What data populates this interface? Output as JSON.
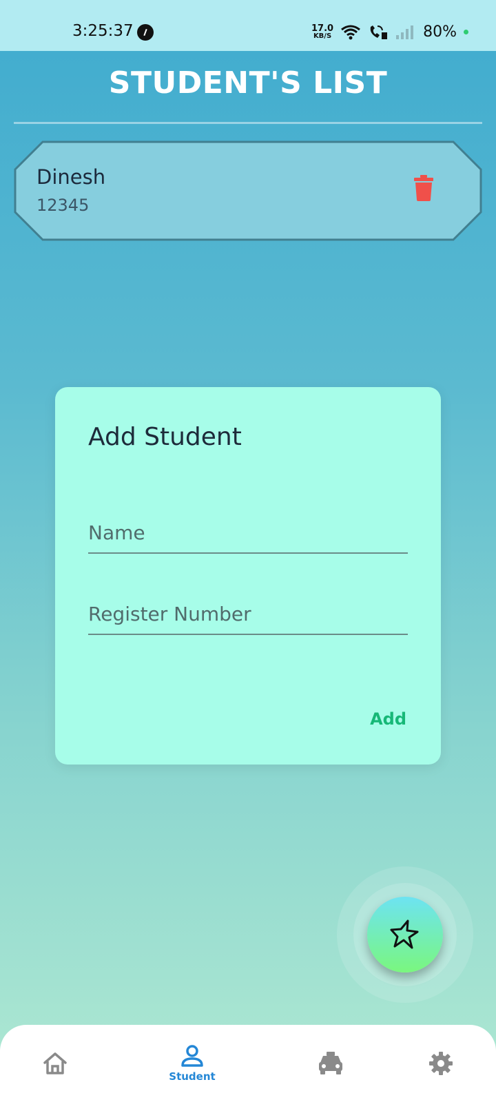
{
  "status_bar": {
    "time": "3:25:37",
    "net_speed_value": "17.0",
    "net_speed_unit": "KB/S",
    "battery": "80%"
  },
  "header": {
    "title": "STUDENT'S LIST"
  },
  "students": [
    {
      "name": "Dinesh",
      "register_number": "12345"
    }
  ],
  "dialog": {
    "title": "Add Student",
    "name_placeholder": "Name",
    "register_placeholder": "Register Number",
    "add_label": "Add"
  },
  "bottom_nav": {
    "items": [
      {
        "icon": "home-icon",
        "label": ""
      },
      {
        "icon": "person-icon",
        "label": "Student"
      },
      {
        "icon": "car-icon",
        "label": ""
      },
      {
        "icon": "gear-icon",
        "label": ""
      }
    ],
    "active_color": "#2487d6",
    "inactive_color": "#8a8a8a"
  },
  "colors": {
    "delete": "#f0504a",
    "add": "#16b877",
    "dialog_bg": "#a7fde9"
  }
}
